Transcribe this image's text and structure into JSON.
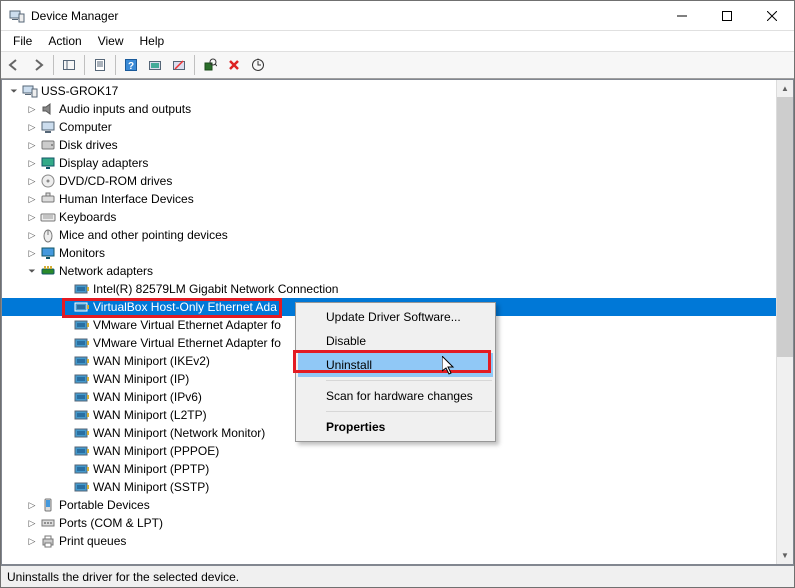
{
  "window": {
    "title": "Device Manager",
    "status": "Uninstalls the driver for the selected device."
  },
  "menubar": [
    "File",
    "Action",
    "View",
    "Help"
  ],
  "tree": {
    "root": {
      "label": "USS-GROK17"
    },
    "categories": [
      {
        "label": "Audio inputs and outputs",
        "icon": "audio"
      },
      {
        "label": "Computer",
        "icon": "computer"
      },
      {
        "label": "Disk drives",
        "icon": "disk"
      },
      {
        "label": "Display adapters",
        "icon": "display"
      },
      {
        "label": "DVD/CD-ROM drives",
        "icon": "cd"
      },
      {
        "label": "Human Interface Devices",
        "icon": "hid"
      },
      {
        "label": "Keyboards",
        "icon": "keyboard"
      },
      {
        "label": "Mice and other pointing devices",
        "icon": "mouse"
      },
      {
        "label": "Monitors",
        "icon": "monitor"
      },
      {
        "label": "Network adapters",
        "icon": "network",
        "expanded": true
      },
      {
        "label": "Portable Devices",
        "icon": "portable"
      },
      {
        "label": "Ports (COM & LPT)",
        "icon": "ports"
      },
      {
        "label": "Print queues",
        "icon": "print"
      }
    ],
    "network_children": [
      {
        "label": "Intel(R) 82579LM Gigabit Network Connection"
      },
      {
        "label": "VirtualBox Host-Only Ethernet Ada",
        "selected": true
      },
      {
        "label": "VMware Virtual Ethernet Adapter fo"
      },
      {
        "label": "VMware Virtual Ethernet Adapter fo"
      },
      {
        "label": "WAN Miniport (IKEv2)"
      },
      {
        "label": "WAN Miniport (IP)"
      },
      {
        "label": "WAN Miniport (IPv6)"
      },
      {
        "label": "WAN Miniport (L2TP)"
      },
      {
        "label": "WAN Miniport (Network Monitor)"
      },
      {
        "label": "WAN Miniport (PPPOE)"
      },
      {
        "label": "WAN Miniport (PPTP)"
      },
      {
        "label": "WAN Miniport (SSTP)"
      }
    ]
  },
  "context_menu": {
    "items": [
      {
        "label": "Update Driver Software..."
      },
      {
        "label": "Disable"
      },
      {
        "label": "Uninstall",
        "highlighted": true
      },
      {
        "separator": true
      },
      {
        "label": "Scan for hardware changes"
      },
      {
        "separator": true
      },
      {
        "label": "Properties",
        "bold": true
      }
    ]
  }
}
